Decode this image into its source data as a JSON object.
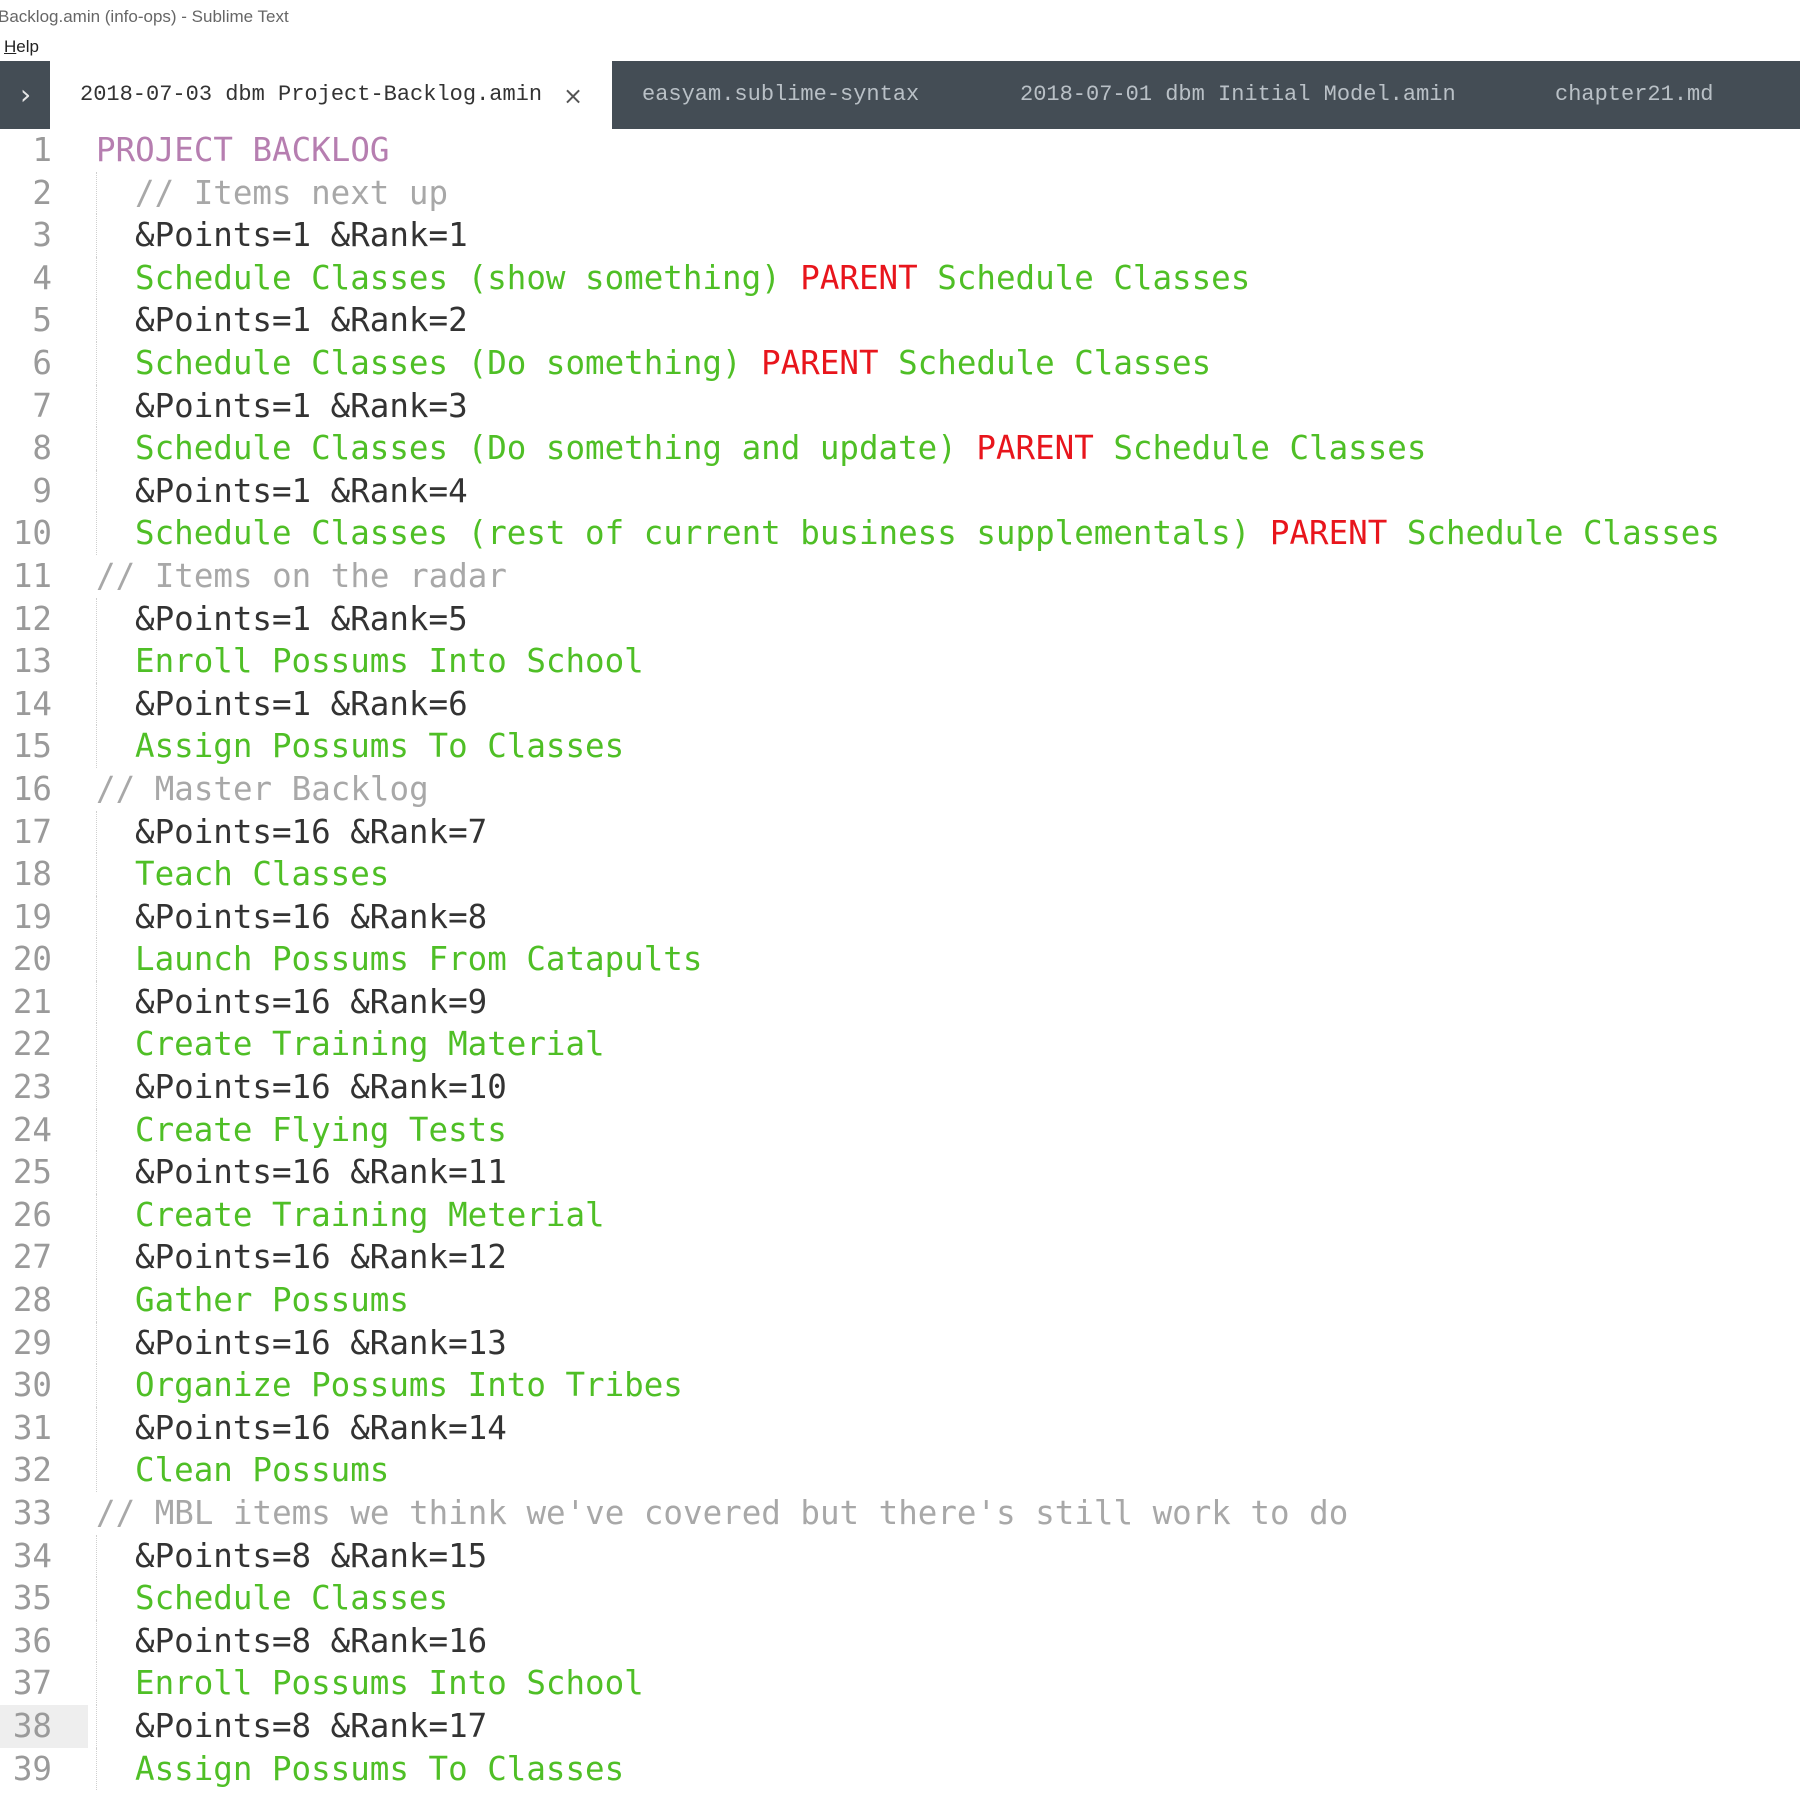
{
  "window": {
    "title": "Backlog.amin (info-ops) - Sublime Text"
  },
  "menu": {
    "help_mnemonic": "H",
    "help_rest": "elp"
  },
  "tabs": [
    {
      "label": "2018-07-03 dbm Project-Backlog.amin",
      "active": true
    },
    {
      "label": "easyam.sublime-syntax",
      "active": false
    },
    {
      "label": "2018-07-01 dbm Initial Model.amin",
      "active": false
    },
    {
      "label": "chapter21.md",
      "active": false
    }
  ],
  "nav": {
    "left_icon": "chevron-left-icon",
    "right_icon": "chevron-right-icon"
  },
  "colors": {
    "heading": "#b67eb0",
    "comment": "#a8a8a8",
    "attribute": "#333333",
    "item": "#4fbf26",
    "keyword": "#e8151c",
    "tabbar": "#444d55"
  },
  "editor": {
    "current_line": 38,
    "lines": [
      {
        "n": "1",
        "indent": 0,
        "segments": [
          {
            "t": "PROJECT BACKLOG",
            "c": "heading"
          }
        ]
      },
      {
        "n": "2",
        "indent": 1,
        "segments": [
          {
            "t": "// Items next up",
            "c": "comment"
          }
        ]
      },
      {
        "n": "3",
        "indent": 1,
        "segments": [
          {
            "t": "&Points=1 &Rank=1",
            "c": "attr"
          }
        ]
      },
      {
        "n": "4",
        "indent": 1,
        "segments": [
          {
            "t": "Schedule Classes (show something) ",
            "c": "item"
          },
          {
            "t": "PARENT",
            "c": "kw"
          },
          {
            "t": " Schedule Classes",
            "c": "item"
          }
        ]
      },
      {
        "n": "5",
        "indent": 1,
        "segments": [
          {
            "t": "&Points=1 &Rank=2",
            "c": "attr"
          }
        ]
      },
      {
        "n": "6",
        "indent": 1,
        "segments": [
          {
            "t": "Schedule Classes (Do something) ",
            "c": "item"
          },
          {
            "t": "PARENT",
            "c": "kw"
          },
          {
            "t": " Schedule Classes",
            "c": "item"
          }
        ]
      },
      {
        "n": "7",
        "indent": 1,
        "segments": [
          {
            "t": "&Points=1 &Rank=3",
            "c": "attr"
          }
        ]
      },
      {
        "n": "8",
        "indent": 1,
        "segments": [
          {
            "t": "Schedule Classes (Do something and update) ",
            "c": "item"
          },
          {
            "t": "PARENT",
            "c": "kw"
          },
          {
            "t": " Schedule Classes",
            "c": "item"
          }
        ]
      },
      {
        "n": "9",
        "indent": 1,
        "segments": [
          {
            "t": "&Points=1 &Rank=4",
            "c": "attr"
          }
        ]
      },
      {
        "n": "10",
        "indent": 1,
        "segments": [
          {
            "t": "Schedule Classes (rest of current business supplementals) ",
            "c": "item"
          },
          {
            "t": "PARENT",
            "c": "kw"
          },
          {
            "t": " Schedule Classes",
            "c": "item"
          }
        ]
      },
      {
        "n": "11",
        "indent": 0,
        "segments": [
          {
            "t": "// Items on the radar",
            "c": "comment"
          }
        ]
      },
      {
        "n": "12",
        "indent": 1,
        "segments": [
          {
            "t": "&Points=1 &Rank=5",
            "c": "attr"
          }
        ]
      },
      {
        "n": "13",
        "indent": 1,
        "segments": [
          {
            "t": "Enroll Possums Into School",
            "c": "item"
          }
        ]
      },
      {
        "n": "14",
        "indent": 1,
        "segments": [
          {
            "t": "&Points=1 &Rank=6",
            "c": "attr"
          }
        ]
      },
      {
        "n": "15",
        "indent": 1,
        "segments": [
          {
            "t": "Assign Possums To Classes",
            "c": "item"
          }
        ]
      },
      {
        "n": "16",
        "indent": 0,
        "segments": [
          {
            "t": "// Master Backlog",
            "c": "comment"
          }
        ]
      },
      {
        "n": "17",
        "indent": 1,
        "segments": [
          {
            "t": "&Points=16 &Rank=7",
            "c": "attr"
          }
        ]
      },
      {
        "n": "18",
        "indent": 1,
        "segments": [
          {
            "t": "Teach Classes",
            "c": "item"
          }
        ]
      },
      {
        "n": "19",
        "indent": 1,
        "segments": [
          {
            "t": "&Points=16 &Rank=8",
            "c": "attr"
          }
        ]
      },
      {
        "n": "20",
        "indent": 1,
        "segments": [
          {
            "t": "Launch Possums From Catapults",
            "c": "item"
          }
        ]
      },
      {
        "n": "21",
        "indent": 1,
        "segments": [
          {
            "t": "&Points=16 &Rank=9",
            "c": "attr"
          }
        ]
      },
      {
        "n": "22",
        "indent": 1,
        "segments": [
          {
            "t": "Create Training Material",
            "c": "item"
          }
        ]
      },
      {
        "n": "23",
        "indent": 1,
        "segments": [
          {
            "t": "&Points=16 &Rank=10",
            "c": "attr"
          }
        ]
      },
      {
        "n": "24",
        "indent": 1,
        "segments": [
          {
            "t": "Create Flying Tests",
            "c": "item"
          }
        ]
      },
      {
        "n": "25",
        "indent": 1,
        "segments": [
          {
            "t": "&Points=16 &Rank=11",
            "c": "attr"
          }
        ]
      },
      {
        "n": "26",
        "indent": 1,
        "segments": [
          {
            "t": "Create Training Meterial",
            "c": "item"
          }
        ]
      },
      {
        "n": "27",
        "indent": 1,
        "segments": [
          {
            "t": "&Points=16 &Rank=12",
            "c": "attr"
          }
        ]
      },
      {
        "n": "28",
        "indent": 1,
        "segments": [
          {
            "t": "Gather Possums",
            "c": "item"
          }
        ]
      },
      {
        "n": "29",
        "indent": 1,
        "segments": [
          {
            "t": "&Points=16 &Rank=13",
            "c": "attr"
          }
        ]
      },
      {
        "n": "30",
        "indent": 1,
        "segments": [
          {
            "t": "Organize Possums Into Tribes",
            "c": "item"
          }
        ]
      },
      {
        "n": "31",
        "indent": 1,
        "segments": [
          {
            "t": "&Points=16 &Rank=14",
            "c": "attr"
          }
        ]
      },
      {
        "n": "32",
        "indent": 1,
        "segments": [
          {
            "t": "Clean Possums",
            "c": "item"
          }
        ]
      },
      {
        "n": "33",
        "indent": 0,
        "segments": [
          {
            "t": "// MBL items we think we've covered but there's still work to do",
            "c": "comment"
          }
        ]
      },
      {
        "n": "34",
        "indent": 1,
        "segments": [
          {
            "t": "&Points=8 &Rank=15",
            "c": "attr"
          }
        ]
      },
      {
        "n": "35",
        "indent": 1,
        "segments": [
          {
            "t": "Schedule Classes",
            "c": "item"
          }
        ]
      },
      {
        "n": "36",
        "indent": 1,
        "segments": [
          {
            "t": "&Points=8 &Rank=16",
            "c": "attr"
          }
        ]
      },
      {
        "n": "37",
        "indent": 1,
        "segments": [
          {
            "t": "Enroll Possums Into School",
            "c": "item"
          }
        ]
      },
      {
        "n": "38",
        "indent": 1,
        "segments": [
          {
            "t": "&Points=8 &Rank=17",
            "c": "attr"
          }
        ]
      },
      {
        "n": "39",
        "indent": 1,
        "segments": [
          {
            "t": "Assign Possums To Classes",
            "c": "item"
          }
        ]
      }
    ]
  }
}
